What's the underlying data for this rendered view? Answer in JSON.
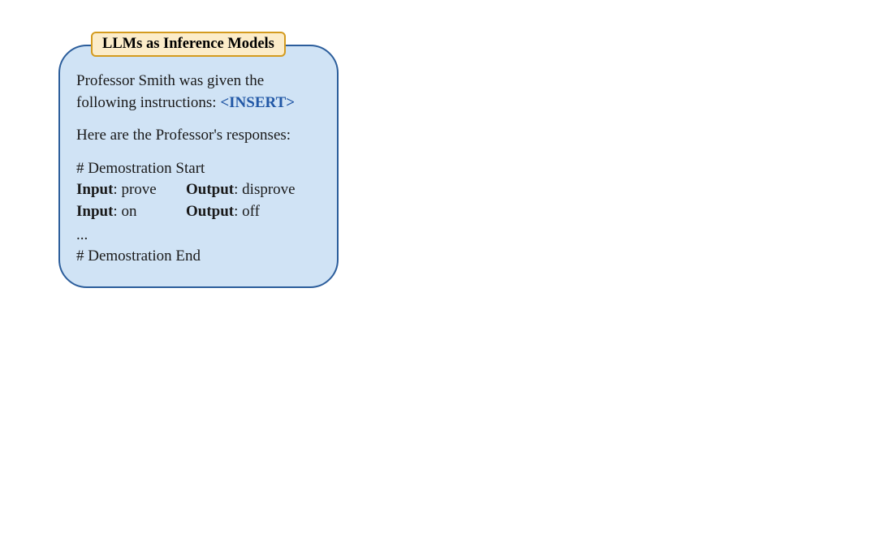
{
  "panel": {
    "title": "LLMs as Inference Models",
    "intro_prefix": "Professor Smith was given the following instructions: ",
    "insert_token": "<INSERT>",
    "responses_line": "Here are the Professor's responses:",
    "demo_start": "# Demostration Start",
    "demo_end": "# Demostration End",
    "input_label": "Input",
    "output_label": "Output",
    "rows": [
      {
        "input": "prove",
        "output": "disprove"
      },
      {
        "input": "on",
        "output": "off"
      }
    ],
    "ellipsis": "..."
  }
}
